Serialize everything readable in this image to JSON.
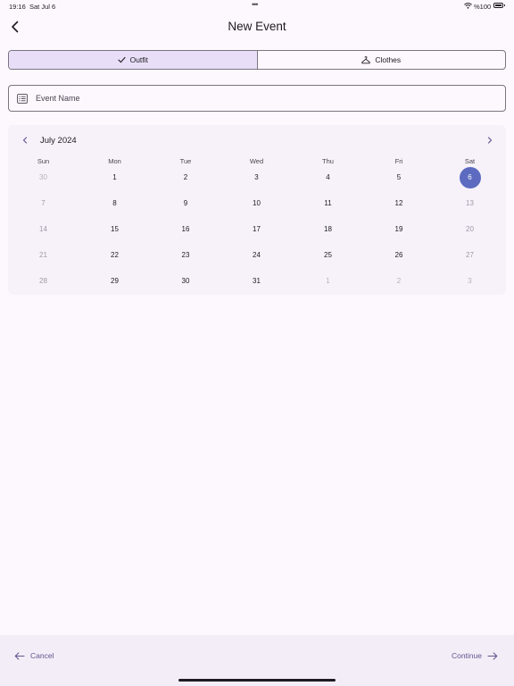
{
  "status_bar": {
    "time": "19:16",
    "date": "Sat Jul 6",
    "battery": "%100"
  },
  "app_bar": {
    "title": "New Event"
  },
  "segments": [
    {
      "label": "Outfit",
      "icon": "check-icon",
      "selected": true
    },
    {
      "label": "Clothes",
      "icon": "hanger-icon",
      "selected": false
    }
  ],
  "event_name": {
    "placeholder": "Event Name",
    "value": ""
  },
  "calendar": {
    "month_label": "July 2024",
    "weekdays": [
      "Sun",
      "Mon",
      "Tue",
      "Wed",
      "Thu",
      "Fri",
      "Sat"
    ],
    "weeks": [
      [
        "30",
        "1",
        "2",
        "3",
        "4",
        "5",
        "6"
      ],
      [
        "7",
        "8",
        "9",
        "10",
        "11",
        "12",
        "13"
      ],
      [
        "14",
        "15",
        "16",
        "17",
        "18",
        "19",
        "20"
      ],
      [
        "21",
        "22",
        "23",
        "24",
        "25",
        "26",
        "27"
      ],
      [
        "28",
        "29",
        "30",
        "31",
        "1",
        "2",
        "3"
      ]
    ],
    "outside": [
      [
        0,
        0
      ],
      [
        4,
        4
      ],
      [
        4,
        5
      ],
      [
        4,
        6
      ]
    ],
    "selected": [
      0,
      6
    ],
    "colors": {
      "selected": "#5c6bc0",
      "accent": "#65558f"
    }
  },
  "bottom_bar": {
    "cancel_label": "Cancel",
    "continue_label": "Continue"
  }
}
